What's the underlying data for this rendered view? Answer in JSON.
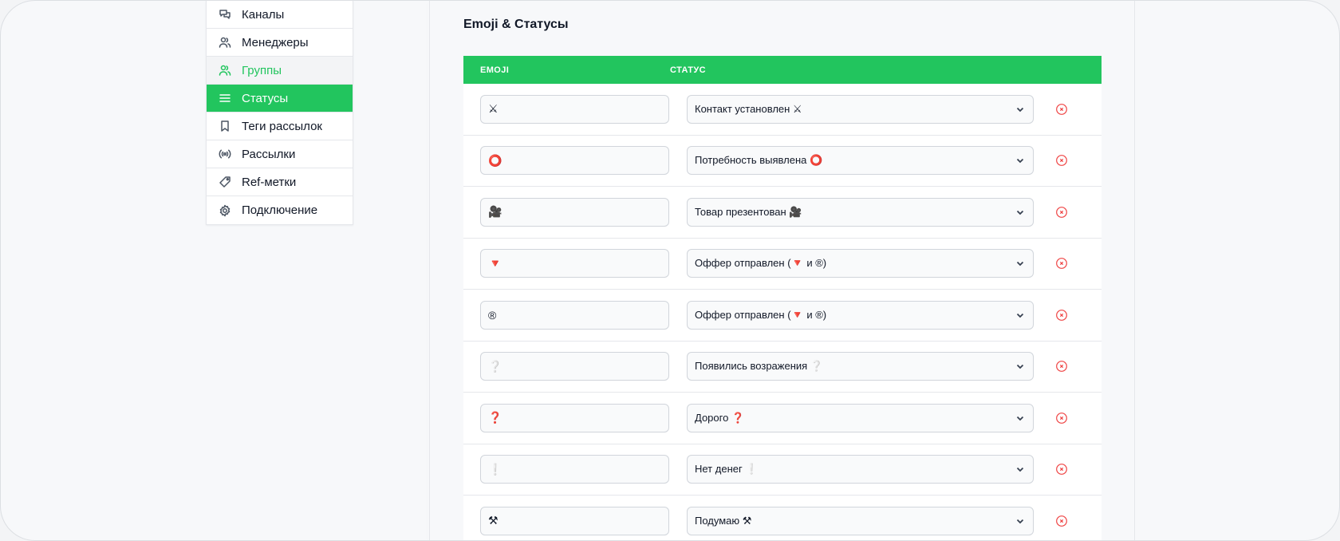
{
  "sidebar": {
    "items": [
      {
        "label": "Каналы",
        "icon": "chat-bubbles-icon",
        "state": "default"
      },
      {
        "label": "Менеджеры",
        "icon": "users-icon",
        "state": "default"
      },
      {
        "label": "Группы",
        "icon": "user-group-icon",
        "state": "hover"
      },
      {
        "label": "Статусы",
        "icon": "list-icon",
        "state": "active"
      },
      {
        "label": "Теги рассылок",
        "icon": "bookmark-icon",
        "state": "default"
      },
      {
        "label": "Рассылки",
        "icon": "broadcast-icon",
        "state": "default"
      },
      {
        "label": "Ref-метки",
        "icon": "tag-icon",
        "state": "default"
      },
      {
        "label": "Подключение",
        "icon": "gear-icon",
        "state": "default"
      }
    ]
  },
  "main": {
    "title": "Emoji & Статусы",
    "table": {
      "headers": {
        "emoji": "EMOJI",
        "status": "СТАТУС"
      },
      "rows": [
        {
          "emoji": "⚔",
          "status": "Контакт установлен ⚔"
        },
        {
          "emoji": "⭕",
          "status": "Потребность выявлена ⭕"
        },
        {
          "emoji": "🎥",
          "status": "Товар презентован 🎥"
        },
        {
          "emoji": "🔻",
          "status": "Оффер отправлен (🔻 и ®)"
        },
        {
          "emoji": "®",
          "status": "Оффер отправлен (🔻 и ®)"
        },
        {
          "emoji": "❔",
          "status": "Появились возражения ❔"
        },
        {
          "emoji": "❓",
          "status": "Дорого ❓"
        },
        {
          "emoji": "❕",
          "status": "Нет денег ❕"
        },
        {
          "emoji": "⚒",
          "status": "Подумаю ⚒"
        }
      ]
    }
  },
  "colors": {
    "accent": "#22c55e",
    "delete": "#ef4444"
  }
}
